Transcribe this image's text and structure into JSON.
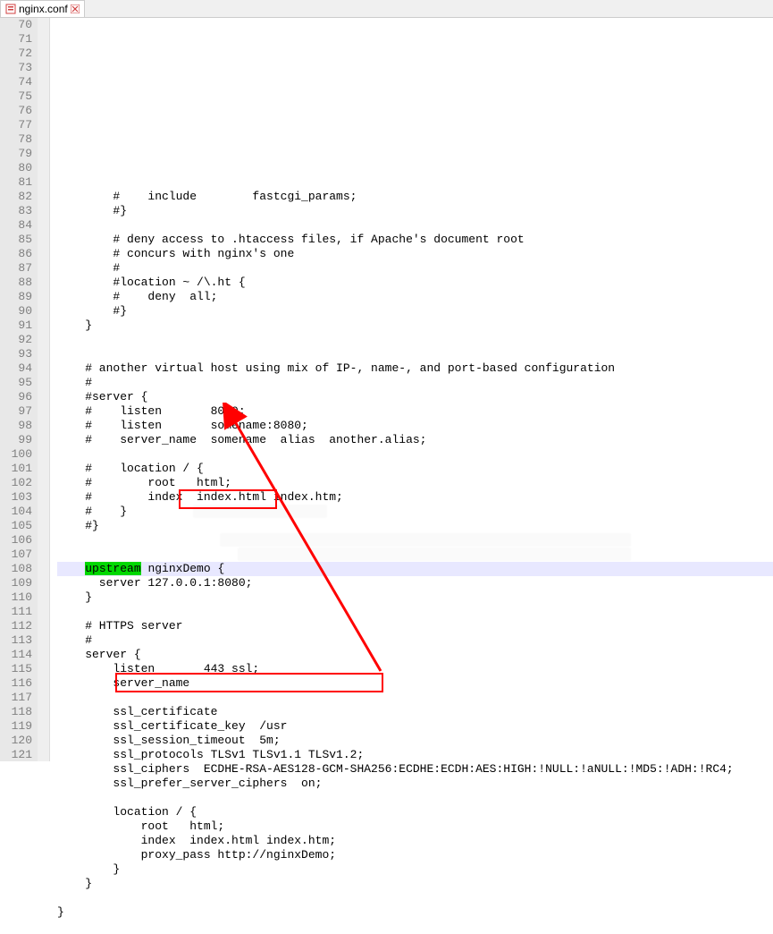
{
  "tab": {
    "filename": "nginx.conf",
    "icon_name": "file-icon",
    "close_name": "close-icon"
  },
  "lines": [
    {
      "n": 70,
      "text": "        #    include        fastcgi_params;"
    },
    {
      "n": 71,
      "text": "        #}"
    },
    {
      "n": 72,
      "text": ""
    },
    {
      "n": 73,
      "text": "        # deny access to .htaccess files, if Apache's document root"
    },
    {
      "n": 74,
      "text": "        # concurs with nginx's one"
    },
    {
      "n": 75,
      "text": "        #"
    },
    {
      "n": 76,
      "text": "        #location ~ /\\.ht {"
    },
    {
      "n": 77,
      "text": "        #    deny  all;"
    },
    {
      "n": 78,
      "text": "        #}"
    },
    {
      "n": 79,
      "text": "    }"
    },
    {
      "n": 80,
      "text": ""
    },
    {
      "n": 81,
      "text": ""
    },
    {
      "n": 82,
      "text": "    # another virtual host using mix of IP-, name-, and port-based configuration"
    },
    {
      "n": 83,
      "text": "    #"
    },
    {
      "n": 84,
      "text": "    #server {"
    },
    {
      "n": 85,
      "text": "    #    listen       8000;"
    },
    {
      "n": 86,
      "text": "    #    listen       somename:8080;"
    },
    {
      "n": 87,
      "text": "    #    server_name  somename  alias  another.alias;"
    },
    {
      "n": 88,
      "text": ""
    },
    {
      "n": 89,
      "text": "    #    location / {"
    },
    {
      "n": 90,
      "text": "    #        root   html;"
    },
    {
      "n": 91,
      "text": "    #        index  index.html index.htm;"
    },
    {
      "n": 92,
      "text": "    #    }"
    },
    {
      "n": 93,
      "text": "    #}"
    },
    {
      "n": 94,
      "text": ""
    },
    {
      "n": 95,
      "text": ""
    },
    {
      "n": 96,
      "text": "",
      "special": "upstream",
      "rest": " nginxDemo {",
      "highlightLine": true
    },
    {
      "n": 97,
      "text": "      server 127.0.0.1:8080;"
    },
    {
      "n": 98,
      "text": "    }"
    },
    {
      "n": 99,
      "text": ""
    },
    {
      "n": 100,
      "text": "    # HTTPS server"
    },
    {
      "n": 101,
      "text": "    #"
    },
    {
      "n": 102,
      "text": "    server {"
    },
    {
      "n": 103,
      "text": "        listen       443 ssl;"
    },
    {
      "n": 104,
      "text": "        server_name  "
    },
    {
      "n": 105,
      "text": ""
    },
    {
      "n": 106,
      "text": "        ssl_certificate      "
    },
    {
      "n": 107,
      "text": "        ssl_certificate_key  /usr"
    },
    {
      "n": 108,
      "text": "        ssl_session_timeout  5m;"
    },
    {
      "n": 109,
      "text": "        ssl_protocols TLSv1 TLSv1.1 TLSv1.2;"
    },
    {
      "n": 110,
      "text": "        ssl_ciphers  ECDHE-RSA-AES128-GCM-SHA256:ECDHE:ECDH:AES:HIGH:!NULL:!aNULL:!MD5:!ADH:!RC4;"
    },
    {
      "n": 111,
      "text": "        ssl_prefer_server_ciphers  on;"
    },
    {
      "n": 112,
      "text": ""
    },
    {
      "n": 113,
      "text": "        location / {"
    },
    {
      "n": 114,
      "text": "            root   html;"
    },
    {
      "n": 115,
      "text": "            index  index.html index.htm;"
    },
    {
      "n": 116,
      "text": "            proxy_pass http://nginxDemo;"
    },
    {
      "n": 117,
      "text": "        }"
    },
    {
      "n": 118,
      "text": "    }"
    },
    {
      "n": 119,
      "text": ""
    },
    {
      "n": 120,
      "text": "}"
    },
    {
      "n": 121,
      "text": ""
    }
  ],
  "annotations": {
    "box1": {
      "top_line": 103,
      "text": "443 ssl;"
    },
    "box2": {
      "top_line": 116,
      "text": "proxy_pass http://nginxDemo;"
    },
    "arrow": {
      "from_line": 116,
      "to_line": 97
    }
  }
}
